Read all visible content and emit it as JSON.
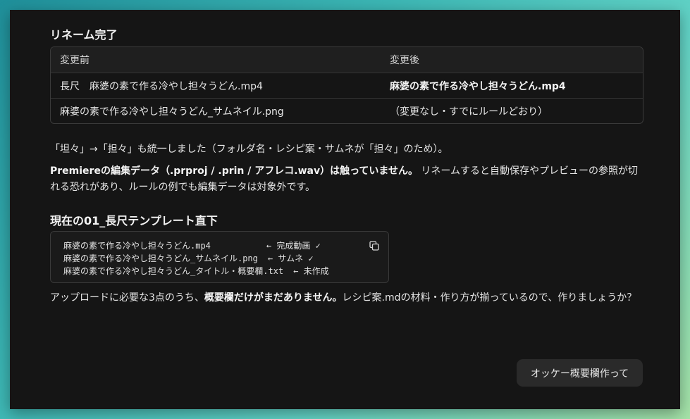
{
  "rename": {
    "title": "リネーム完了",
    "headers": [
      "変更前",
      "変更後"
    ],
    "rows": [
      {
        "before": "長尺　麻婆の素で作る冷やし担々うどん.mp4",
        "after": "麻婆の素で作る冷やし担々うどん.mp4"
      },
      {
        "before": "麻婆の素で作る冷やし担々うどん_サムネイル.png",
        "after": "（変更なし・すでにルールどおり）"
      }
    ]
  },
  "note1": "「坦々」→「担々」も統一しました（フォルダ名・レシピ案・サムネが「担々」のため）。",
  "note2": {
    "bold": "Premiereの編集データ（.prproj / .prin / アフレコ.wav）は触っていません。",
    "rest": " リネームすると自動保存やプレビューの参照が切れる恐れがあり、ルールの例でも編集データは対象外です。"
  },
  "folder": {
    "title": "現在の01_長尺テンプレート直下",
    "lines": [
      {
        "file": "麻婆の素で作る冷やし担々うどん.mp4         ",
        "note": "← 完成動画 ✓"
      },
      {
        "file": "麻婆の素で作る冷やし担々うどん_サムネイル.png",
        "note": "← サムネ ✓"
      },
      {
        "file": "麻婆の素で作る冷やし担々うどん_タイトル・概要欄.txt",
        "note": "← 未作成"
      }
    ],
    "copy_icon": "copy-icon"
  },
  "note3": {
    "pre": "アップロードに必要な3点のうち、",
    "bold": "概要欄だけがまだありません。",
    "post": "レシピ案.mdの材料・作り方が揃っているので、作りましょうか？"
  },
  "action": {
    "label": "オッケー概要欄作って"
  }
}
